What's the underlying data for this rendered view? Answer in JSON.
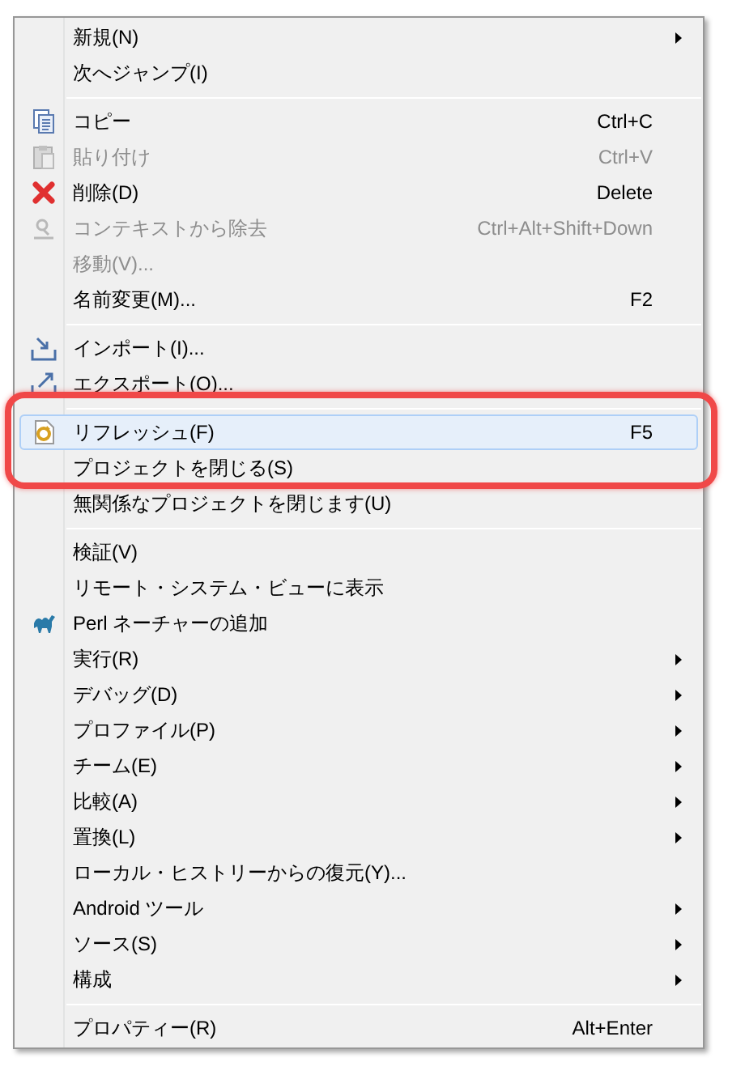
{
  "menu": {
    "items": [
      {
        "kind": "item",
        "label": "新規(N)",
        "submenu": true,
        "disabled": false,
        "selected": false,
        "annotated": false
      },
      {
        "kind": "item",
        "label": "次へジャンプ(I)",
        "submenu": false,
        "disabled": false,
        "selected": false,
        "annotated": false
      },
      {
        "kind": "separator"
      },
      {
        "kind": "item",
        "label": "コピー",
        "shortcut": "Ctrl+C",
        "submenu": false,
        "disabled": false,
        "selected": false,
        "annotated": false
      },
      {
        "kind": "item",
        "label": "貼り付け",
        "shortcut": "Ctrl+V",
        "submenu": false,
        "disabled": true,
        "selected": false,
        "annotated": false
      },
      {
        "kind": "item",
        "label": "削除(D)",
        "shortcut": "Delete",
        "submenu": false,
        "disabled": false,
        "selected": false,
        "annotated": false
      },
      {
        "kind": "item",
        "label": "コンテキストから除去",
        "shortcut": "Ctrl+Alt+Shift+Down",
        "submenu": false,
        "disabled": true,
        "selected": false,
        "annotated": false
      },
      {
        "kind": "item",
        "label": "移動(V)...",
        "submenu": false,
        "disabled": true,
        "selected": false,
        "annotated": false
      },
      {
        "kind": "item",
        "label": "名前変更(M)...",
        "shortcut": "F2",
        "submenu": false,
        "disabled": false,
        "selected": false,
        "annotated": false
      },
      {
        "kind": "separator"
      },
      {
        "kind": "item",
        "label": "インポート(I)...",
        "submenu": false,
        "disabled": false,
        "selected": false,
        "annotated": false
      },
      {
        "kind": "item",
        "label": "エクスポート(O)...",
        "submenu": false,
        "disabled": false,
        "selected": false,
        "annotated": false
      },
      {
        "kind": "separator"
      },
      {
        "kind": "item",
        "label": "リフレッシュ(F)",
        "shortcut": "F5",
        "submenu": false,
        "disabled": false,
        "selected": true,
        "annotated": true
      },
      {
        "kind": "item",
        "label": "プロジェクトを閉じる(S)",
        "submenu": false,
        "disabled": false,
        "selected": false,
        "annotated": true
      },
      {
        "kind": "item",
        "label": "無関係なプロジェクトを閉じます(U)",
        "submenu": false,
        "disabled": false,
        "selected": false,
        "annotated": false
      },
      {
        "kind": "separator"
      },
      {
        "kind": "item",
        "label": "検証(V)",
        "submenu": false,
        "disabled": false,
        "selected": false,
        "annotated": false
      },
      {
        "kind": "item",
        "label": "リモート・システム・ビューに表示",
        "submenu": false,
        "disabled": false,
        "selected": false,
        "annotated": false
      },
      {
        "kind": "item",
        "label": "Perl ネーチャーの追加",
        "submenu": false,
        "disabled": false,
        "selected": false,
        "annotated": false
      },
      {
        "kind": "item",
        "label": "実行(R)",
        "submenu": true,
        "disabled": false,
        "selected": false,
        "annotated": false
      },
      {
        "kind": "item",
        "label": "デバッグ(D)",
        "submenu": true,
        "disabled": false,
        "selected": false,
        "annotated": false
      },
      {
        "kind": "item",
        "label": "プロファイル(P)",
        "submenu": true,
        "disabled": false,
        "selected": false,
        "annotated": false
      },
      {
        "kind": "item",
        "label": "チーム(E)",
        "submenu": true,
        "disabled": false,
        "selected": false,
        "annotated": false
      },
      {
        "kind": "item",
        "label": "比較(A)",
        "submenu": true,
        "disabled": false,
        "selected": false,
        "annotated": false
      },
      {
        "kind": "item",
        "label": "置換(L)",
        "submenu": true,
        "disabled": false,
        "selected": false,
        "annotated": false
      },
      {
        "kind": "item",
        "label": "ローカル・ヒストリーからの復元(Y)...",
        "submenu": false,
        "disabled": false,
        "selected": false,
        "annotated": false
      },
      {
        "kind": "item",
        "label": "Android ツール",
        "submenu": true,
        "disabled": false,
        "selected": false,
        "annotated": false
      },
      {
        "kind": "item",
        "label": "ソース(S)",
        "submenu": true,
        "disabled": false,
        "selected": false,
        "annotated": false
      },
      {
        "kind": "item",
        "label": "構成",
        "submenu": true,
        "disabled": false,
        "selected": false,
        "annotated": false
      },
      {
        "kind": "separator"
      },
      {
        "kind": "item",
        "label": "プロパティー(R)",
        "shortcut": "Alt+Enter",
        "submenu": false,
        "disabled": false,
        "selected": false,
        "annotated": false
      }
    ]
  }
}
